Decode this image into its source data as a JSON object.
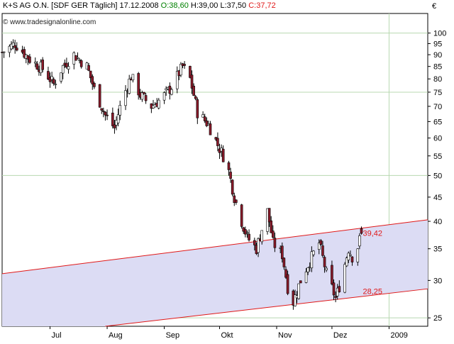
{
  "header": {
    "symbol": "K+S AG O.N. [SDF GER  Täglich] 17.12.2008",
    "open_label": "O:38,60",
    "high_label": "H:39,00",
    "low_label": "L:37,50",
    "close_label": "C:37,72",
    "watermark": "© www.tradesignalonline.com",
    "currency": "€"
  },
  "colors": {
    "bg": "#ffffff",
    "grid": "#b8d8b0",
    "channel_fill": "#dcdcf4",
    "channel_line": "#e01818",
    "up_candle": "#ffffff",
    "down_candle": "#8b1a2a",
    "open_text": "#008000",
    "close_text": "#e01818",
    "axis": "#000000"
  },
  "chart_data": {
    "type": "candlestick",
    "title": "K+S AG O.N. [SDF GER  Täglich] 17.12.2008",
    "y_scale": "log",
    "ylim": [
      24,
      110
    ],
    "y_ticks": [
      25,
      30,
      35,
      40,
      45,
      50,
      55,
      60,
      65,
      70,
      75,
      80,
      85,
      90,
      95,
      100
    ],
    "y_gridlines": [
      25,
      50,
      75,
      100
    ],
    "x_ticks": [
      {
        "date": "2008-07-01",
        "label": "Jul"
      },
      {
        "date": "2008-08-01",
        "label": "Aug"
      },
      {
        "date": "2008-09-01",
        "label": "Sep"
      },
      {
        "date": "2008-10-01",
        "label": "Okt"
      },
      {
        "date": "2008-11-01",
        "label": "Nov"
      },
      {
        "date": "2008-12-01",
        "label": "Dez"
      },
      {
        "date": "2009-01-01",
        "label": "2009"
      }
    ],
    "x_range": [
      "2008-06-05",
      "2009-01-22"
    ],
    "x_gridline": "2009-01-01",
    "last_bar": {
      "date": "2008-12-17",
      "open": 38.6,
      "high": 39.0,
      "low": 37.5,
      "close": 37.72
    },
    "channel": {
      "upper": {
        "start": {
          "date": "2008-06-05",
          "value": 31.0
        },
        "end": {
          "date": "2009-01-22",
          "value": 40.3
        },
        "label": "39,42"
      },
      "lower": {
        "start": {
          "date": "2008-07-31",
          "value": 24.0
        },
        "end": {
          "date": "2009-01-22",
          "value": 28.8
        },
        "label": "28,25"
      }
    },
    "close_path": [
      [
        "2008-06-05",
        91
      ],
      [
        "2008-06-12",
        95
      ],
      [
        "2008-06-20",
        88
      ],
      [
        "2008-06-27",
        84
      ],
      [
        "2008-07-03",
        78
      ],
      [
        "2008-07-08",
        85
      ],
      [
        "2008-07-14",
        90
      ],
      [
        "2008-07-21",
        85
      ],
      [
        "2008-07-25",
        76
      ],
      [
        "2008-07-31",
        67
      ],
      [
        "2008-08-05",
        63
      ],
      [
        "2008-08-09",
        72
      ],
      [
        "2008-08-14",
        81
      ],
      [
        "2008-08-19",
        74
      ],
      [
        "2008-08-25",
        70
      ],
      [
        "2008-08-31",
        73
      ],
      [
        "2008-09-05",
        77
      ],
      [
        "2008-09-11",
        85
      ],
      [
        "2008-09-15",
        80
      ],
      [
        "2008-09-19",
        68
      ],
      [
        "2008-09-25",
        64
      ],
      [
        "2008-09-30",
        58
      ],
      [
        "2008-10-05",
        53
      ],
      [
        "2008-10-09",
        45
      ],
      [
        "2008-10-13",
        40
      ],
      [
        "2008-10-16",
        37
      ],
      [
        "2008-10-21",
        35
      ],
      [
        "2008-10-27",
        42
      ],
      [
        "2008-10-30",
        36
      ],
      [
        "2008-11-04",
        34
      ],
      [
        "2008-11-07",
        29
      ],
      [
        "2008-11-10",
        27
      ],
      [
        "2008-11-14",
        30
      ],
      [
        "2008-11-19",
        33
      ],
      [
        "2008-11-24",
        36
      ],
      [
        "2008-11-28",
        31
      ],
      [
        "2008-12-03",
        27.5
      ],
      [
        "2008-12-06",
        30
      ],
      [
        "2008-12-10",
        35
      ],
      [
        "2008-12-13",
        33
      ],
      [
        "2008-12-17",
        37.72
      ]
    ]
  }
}
